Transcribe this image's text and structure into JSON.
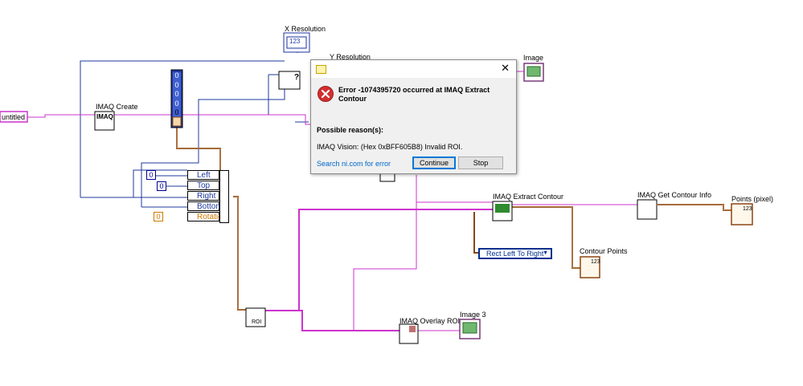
{
  "labels": {
    "x_resolution": "X Resolution",
    "y_resolution": "Y Resolution",
    "image": "Image",
    "imaq_create": "IMAQ Create",
    "imaq_extract_contour": "IMAQ Extract Contour",
    "imaq_get_contour_info": "IMAQ Get Contour Info",
    "points_pixel": "Points (pixel)",
    "contour_points": "Contour Points",
    "imaq_overlay_roi": "IMAQ Overlay ROI",
    "image_3": "Image 3"
  },
  "string_constant": "untitled",
  "node_tags": {
    "imaq_create": "IMAQ",
    "array_index": "123",
    "roi": "ROI",
    "question": "?"
  },
  "cluster_array": [
    "0",
    "0",
    "0",
    "0",
    "0"
  ],
  "unbundle_rows": [
    "Left",
    "Top",
    "Right",
    "Bottom",
    "Rotation"
  ],
  "constants": {
    "left_const": "0",
    "top_const": "0",
    "rotation_const": "0"
  },
  "enum_value": "Rect Left To Right",
  "dialog": {
    "title": "Error -1074395720 occurred at IMAQ Extract Contour",
    "close_glyph": "✕",
    "reason_heading": "Possible reason(s):",
    "reason_text": "IMAQ Vision:  (Hex 0xBFF605B8) Invalid ROI.",
    "link_text": "Search ni.com for error",
    "continue_label": "Continue",
    "stop_label": "Stop"
  },
  "colors": {
    "image_wire": "#cc33cc",
    "cluster_wire": "#8b4513",
    "numeric_wire": "#1f3a9e",
    "string_wire": "#d040d0",
    "error_icon": "#d32f2f",
    "link": "#0066cc"
  },
  "icons": {
    "error": "error-x-icon",
    "app": "labview-app-icon",
    "close": "close-icon"
  }
}
